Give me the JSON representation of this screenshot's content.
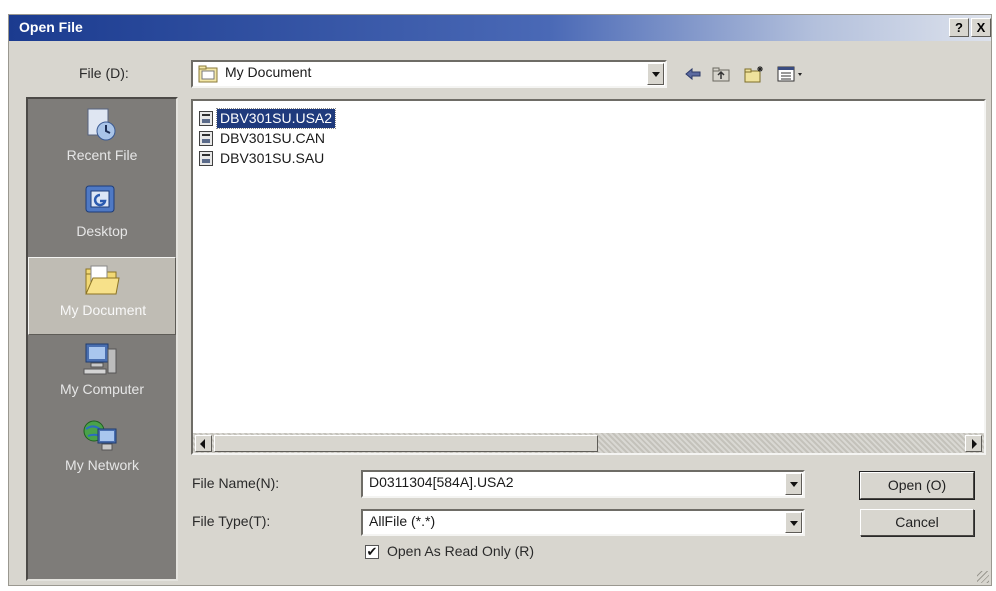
{
  "window": {
    "title": "Open File",
    "help_glyph": "?",
    "close_glyph": "X"
  },
  "look_in": {
    "label": "File (D):",
    "value": "My Document"
  },
  "toolbar": {
    "back_icon": "back-arrow-icon",
    "up_icon": "up-folder-icon",
    "new_folder_icon": "new-folder-icon",
    "view_icon": "view-menu-icon"
  },
  "places": [
    {
      "label": "Recent File",
      "icon": "recent-file-icon"
    },
    {
      "label": "Desktop",
      "icon": "desktop-icon"
    },
    {
      "label": "My Document",
      "icon": "my-document-icon",
      "selected": true
    },
    {
      "label": "My Computer",
      "icon": "my-computer-icon"
    },
    {
      "label": "My Network",
      "icon": "my-network-icon"
    }
  ],
  "files": [
    {
      "name": "DBV301SU.USA2",
      "selected": true
    },
    {
      "name": "DBV301SU.CAN",
      "selected": false
    },
    {
      "name": "DBV301SU.SAU",
      "selected": false
    }
  ],
  "file_name": {
    "label": "File Name(N):",
    "value": "D0311304[584A].USA2"
  },
  "file_type": {
    "label": "File Type(T):",
    "value": "AllFile (*.*)"
  },
  "read_only": {
    "label": "Open As Read Only (R)",
    "checked": true,
    "check_glyph": "✔"
  },
  "buttons": {
    "open": "Open (O)",
    "cancel": "Cancel"
  },
  "colors": {
    "title_bar_start": "#1b3b8f",
    "selection": "#1f3a7c",
    "places_bg": "#7e7c79",
    "dialog_bg": "#d8d6cf"
  }
}
